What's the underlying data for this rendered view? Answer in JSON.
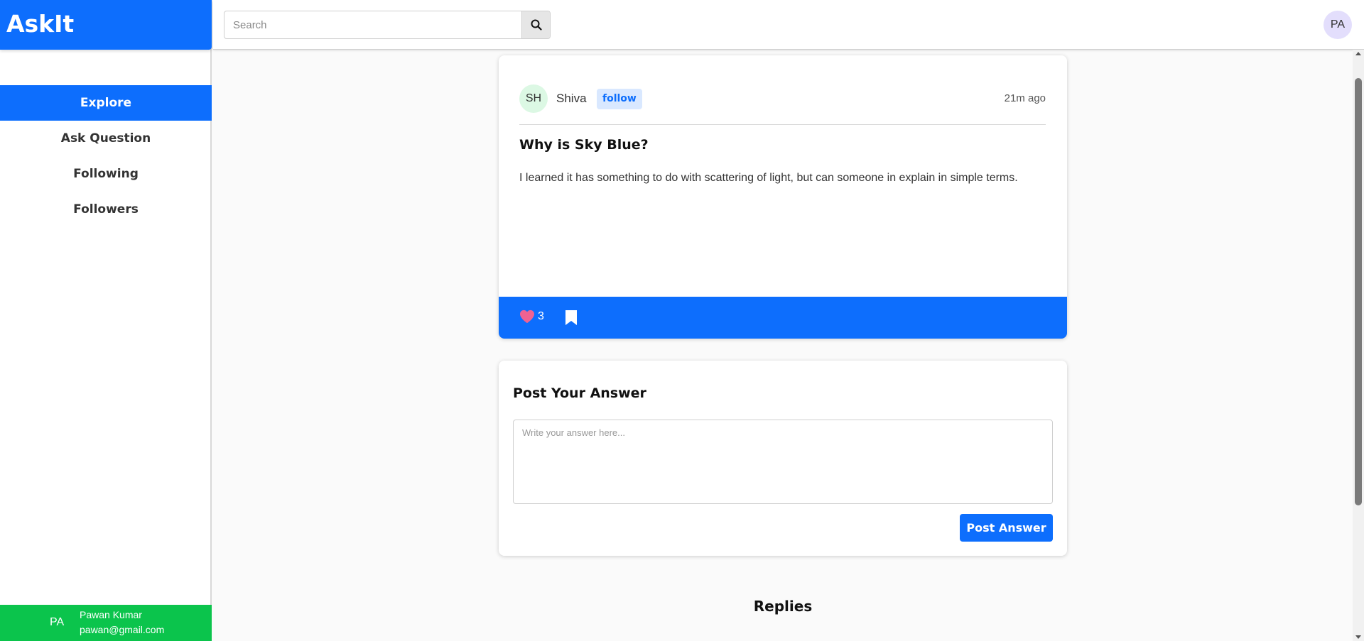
{
  "app": {
    "brand": "AskIt"
  },
  "sidebar": {
    "items": [
      {
        "label": "Explore",
        "active": true
      },
      {
        "label": "Ask Question",
        "active": false
      },
      {
        "label": "Following",
        "active": false
      },
      {
        "label": "Followers",
        "active": false
      }
    ],
    "user": {
      "initials": "PA",
      "name": "Pawan Kumar",
      "email": "pawan@gmail.com"
    }
  },
  "header": {
    "search_placeholder": "Search",
    "search_icon": "search-icon",
    "avatar_initials": "PA"
  },
  "question": {
    "author_initials": "SH",
    "author": "Shiva",
    "follow_label": "follow",
    "time": "21m ago",
    "title": "Why is Sky Blue?",
    "body": "I learned it has something to do with scattering of light, but can someone in explain in simple terms.",
    "likes": "3",
    "like_icon": "heart-icon",
    "bookmark_icon": "bookmark-icon"
  },
  "answer_form": {
    "title": "Post Your Answer",
    "placeholder": "Write your answer here...",
    "submit_label": "Post Answer"
  },
  "replies": {
    "title": "Replies"
  },
  "colors": {
    "primary": "#0d6efd",
    "success": "#0bc44c",
    "heart": "#f06292",
    "follow_bg": "#d9e8ff"
  }
}
